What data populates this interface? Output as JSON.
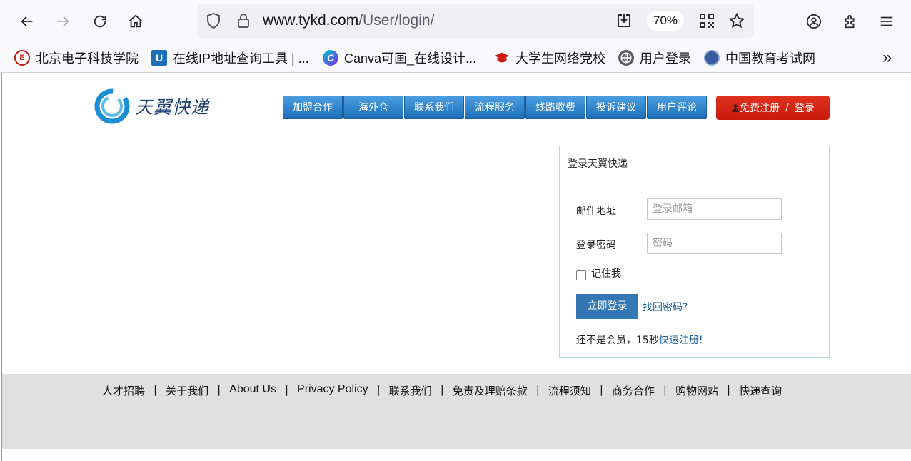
{
  "browser": {
    "url_host": "www.tykd.com",
    "url_path": "/User/login/",
    "zoom": "70%",
    "icons": [
      "back-icon",
      "forward-icon",
      "reload-icon",
      "home-icon",
      "shield-icon",
      "lock-icon",
      "download-icon",
      "qr-code-icon",
      "star-icon",
      "account-icon",
      "extensions-icon",
      "menu-icon"
    ],
    "bookmarks": [
      {
        "label": "北京电子科技学院",
        "icon": "besti-icon"
      },
      {
        "label": "在线IP地址查询工具 | ...",
        "icon": "u-icon"
      },
      {
        "label": "Canva可画_在线设计...",
        "icon": "canva-icon"
      },
      {
        "label": "大学生网络党校",
        "icon": "graduation-cap-icon"
      },
      {
        "label": "用户登录",
        "icon": "globe-icon"
      },
      {
        "label": "中国教育考试网",
        "icon": "neea-icon"
      }
    ],
    "bookmarks_overflow": "»"
  },
  "site": {
    "logo_text": "天翼快递",
    "nav": [
      "加盟合作",
      "海外仓",
      "联系我们",
      "流程服务",
      "线路收费",
      "投诉建议",
      "用户评论"
    ],
    "register_label": "免费注册",
    "register_sep": "/",
    "login_label": "登录"
  },
  "login": {
    "title": "登录天翼快递",
    "email_label": "邮件地址",
    "email_placeholder": "登录邮箱",
    "password_label": "登录密码",
    "password_placeholder": "密码",
    "remember_label": "记住我",
    "submit_label": "立即登录",
    "forgot_label": "找回密码?",
    "signup_prefix": "还不是会员，15秒",
    "signup_link": "快速注册!"
  },
  "footer": {
    "links": [
      "人才招聘",
      "关于我们",
      "About Us",
      "Privacy Policy",
      "联系我们",
      "免责及理赔条款",
      "流程须知",
      "商务合作",
      "购物网站",
      "快递查询"
    ],
    "separator": "|"
  }
}
